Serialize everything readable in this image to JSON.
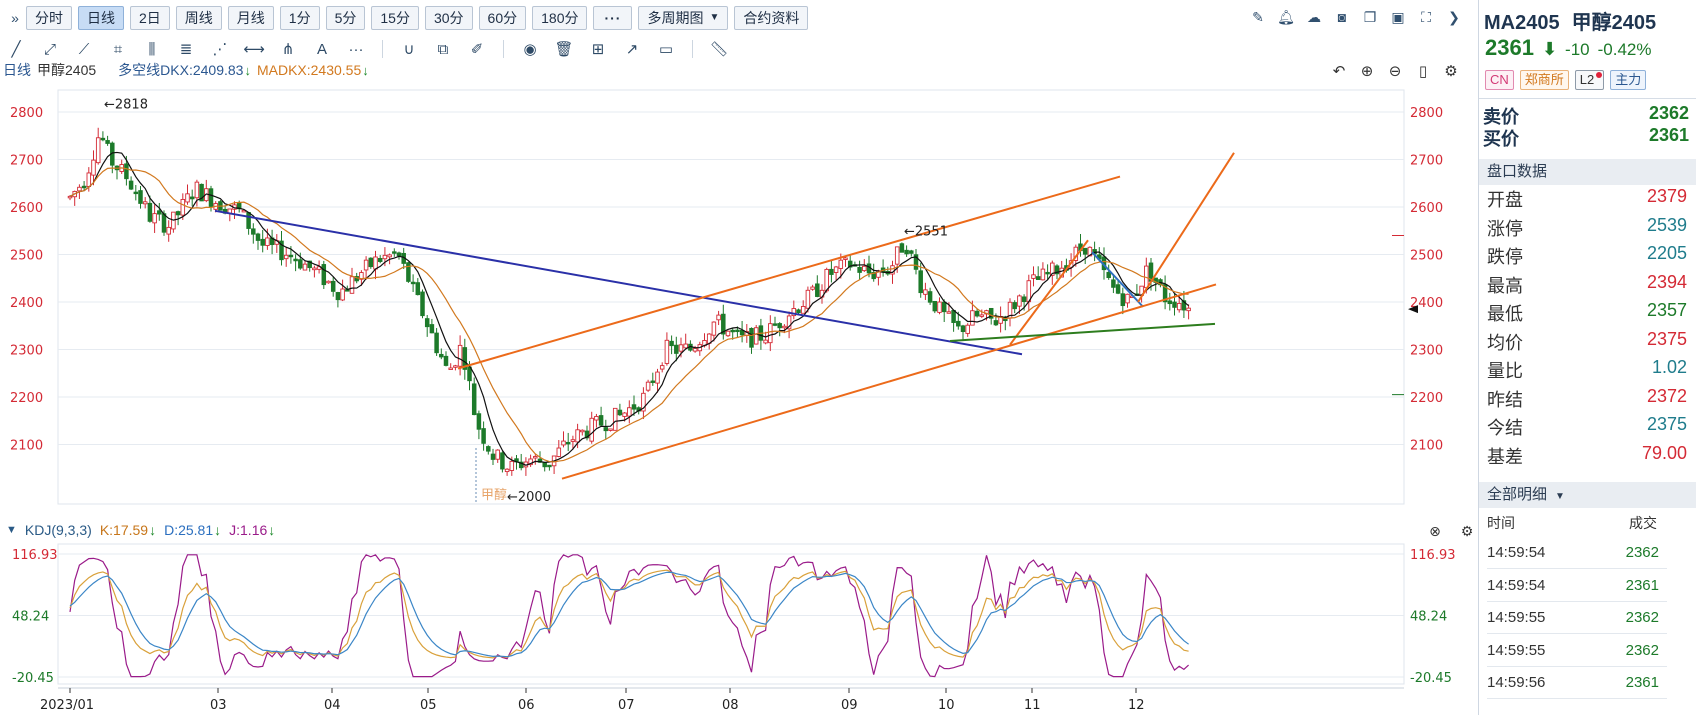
{
  "toolbar": {
    "expand_icon": "double-chevron-right-icon",
    "periods": [
      {
        "label": "分时",
        "active": false
      },
      {
        "label": "日线",
        "active": true
      },
      {
        "label": "2日",
        "active": false
      },
      {
        "label": "周线",
        "active": false
      },
      {
        "label": "月线",
        "active": false
      },
      {
        "label": "1分",
        "active": false
      },
      {
        "label": "5分",
        "active": false
      },
      {
        "label": "15分",
        "active": false
      },
      {
        "label": "30分",
        "active": false
      },
      {
        "label": "60分",
        "active": false
      },
      {
        "label": "180分",
        "active": false
      }
    ],
    "more_label": "···",
    "multi_period_label": "多周期图",
    "contract_info_label": "合约资料"
  },
  "indicator_line": {
    "period": "日线",
    "symbol_name": "甲醇2405",
    "dkx_label": "多空线",
    "dkx_value": "DKX:2409.83",
    "madkx_value": "MADKX:2430.55",
    "down_arrow": "↓"
  },
  "main_chart": {
    "y_ticks": [
      "2800",
      "2700",
      "2600",
      "2500",
      "2400",
      "2300",
      "2200",
      "2100"
    ],
    "annotation_high": "←2818",
    "annotation_mid": "←2551",
    "annotation_low": "←2000",
    "annotation_low_name": "甲醇",
    "x_ticks": [
      "2023/01",
      "03",
      "04",
      "05",
      "06",
      "07",
      "08",
      "09",
      "10",
      "11",
      "12"
    ]
  },
  "kdj": {
    "label": "KDJ(9,3,3)",
    "k": "K:17.59",
    "d": "D:25.81",
    "j": "J:1.16",
    "down_arrow": "↓",
    "y_ticks": [
      "116.93",
      "48.24",
      "-20.45"
    ]
  },
  "right_panel": {
    "code": "MA2405",
    "name": "甲醇2405",
    "last_price": "2361",
    "change": "-10",
    "change_pct": "-0.42%",
    "tags": {
      "cn": "CN",
      "exchange": "郑商所",
      "l2": "L2",
      "main": "主力"
    },
    "ask_label": "卖价",
    "ask": "2362",
    "bid_label": "买价",
    "bid": "2361",
    "quote_section": "盘口数据",
    "quotes": [
      {
        "label": "开盘",
        "value": "2379",
        "color": "red"
      },
      {
        "label": "涨停",
        "value": "2539",
        "color": "teal"
      },
      {
        "label": "跌停",
        "value": "2205",
        "color": "teal"
      },
      {
        "label": "最高",
        "value": "2394",
        "color": "red"
      },
      {
        "label": "最低",
        "value": "2357",
        "color": "green"
      },
      {
        "label": "均价",
        "value": "2375",
        "color": "red"
      },
      {
        "label": "量比",
        "value": "1.02",
        "color": "teal"
      },
      {
        "label": "昨结",
        "value": "2372",
        "color": "red"
      },
      {
        "label": "今结",
        "value": "2375",
        "color": "teal"
      },
      {
        "label": "基差",
        "value": "79.00",
        "color": "red"
      }
    ],
    "detail_section": "全部明细",
    "trade_head": {
      "time": "时间",
      "deal": "成交"
    },
    "trades": [
      {
        "time": "14:59:54",
        "price": "2362"
      },
      {
        "time": "14:59:54",
        "price": "2361"
      },
      {
        "time": "14:59:55",
        "price": "2362"
      },
      {
        "time": "14:59:55",
        "price": "2362"
      },
      {
        "time": "14:59:56",
        "price": "2361"
      }
    ]
  },
  "colors": {
    "up": "#d42a35",
    "down": "#1d7a2a",
    "accent": "#2b5790",
    "trend_blue": "#2a30a8",
    "trend_orange": "#ec6a1a",
    "trend_green": "#2d7d1e"
  },
  "chart_data": {
    "type": "candlestick",
    "y_axis_range": [
      2000,
      2818
    ],
    "grid": true,
    "series": [
      {
        "name": "DKX",
        "values": [
          2409.83
        ]
      },
      {
        "name": "MADKX",
        "values": [
          2430.55
        ]
      }
    ],
    "kdj_y_range": [
      -20.45,
      116.93
    ],
    "kdj_values": {
      "K": 17.59,
      "D": 25.81,
      "J": 1.16
    }
  }
}
